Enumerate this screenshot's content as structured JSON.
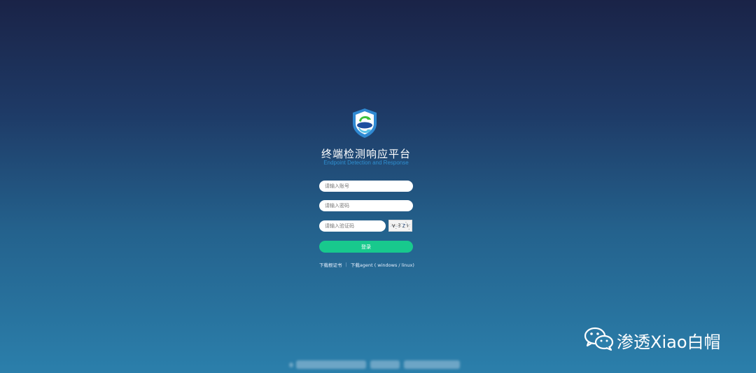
{
  "login": {
    "title": "终端检测响应平台",
    "subtitle": "Endpoint Detection and Response",
    "account_placeholder": "请输入账号",
    "password_placeholder": "请输入密码",
    "captcha_placeholder": "请输入验证码",
    "login_label": "登录",
    "download_cert_label": "下载根证书",
    "separator": "|",
    "download_agent_label": "下载agent ( windows / linux)"
  },
  "logo": {
    "icon": "shield-logo-icon",
    "colors": {
      "outer": "#2f89d2",
      "inner": "#ffffff",
      "accent_green": "#3dc13d",
      "accent_blue": "#1d4f9f"
    }
  },
  "captcha": {
    "icon": "captcha-image"
  },
  "colors": {
    "background_top": "#1a2347",
    "background_bottom": "#2b7fab",
    "button": "#18c98d",
    "subtitle": "#2f8fd0"
  },
  "watermark": {
    "icon": "wechat-icon",
    "text": "渗透Xiao白帽"
  }
}
